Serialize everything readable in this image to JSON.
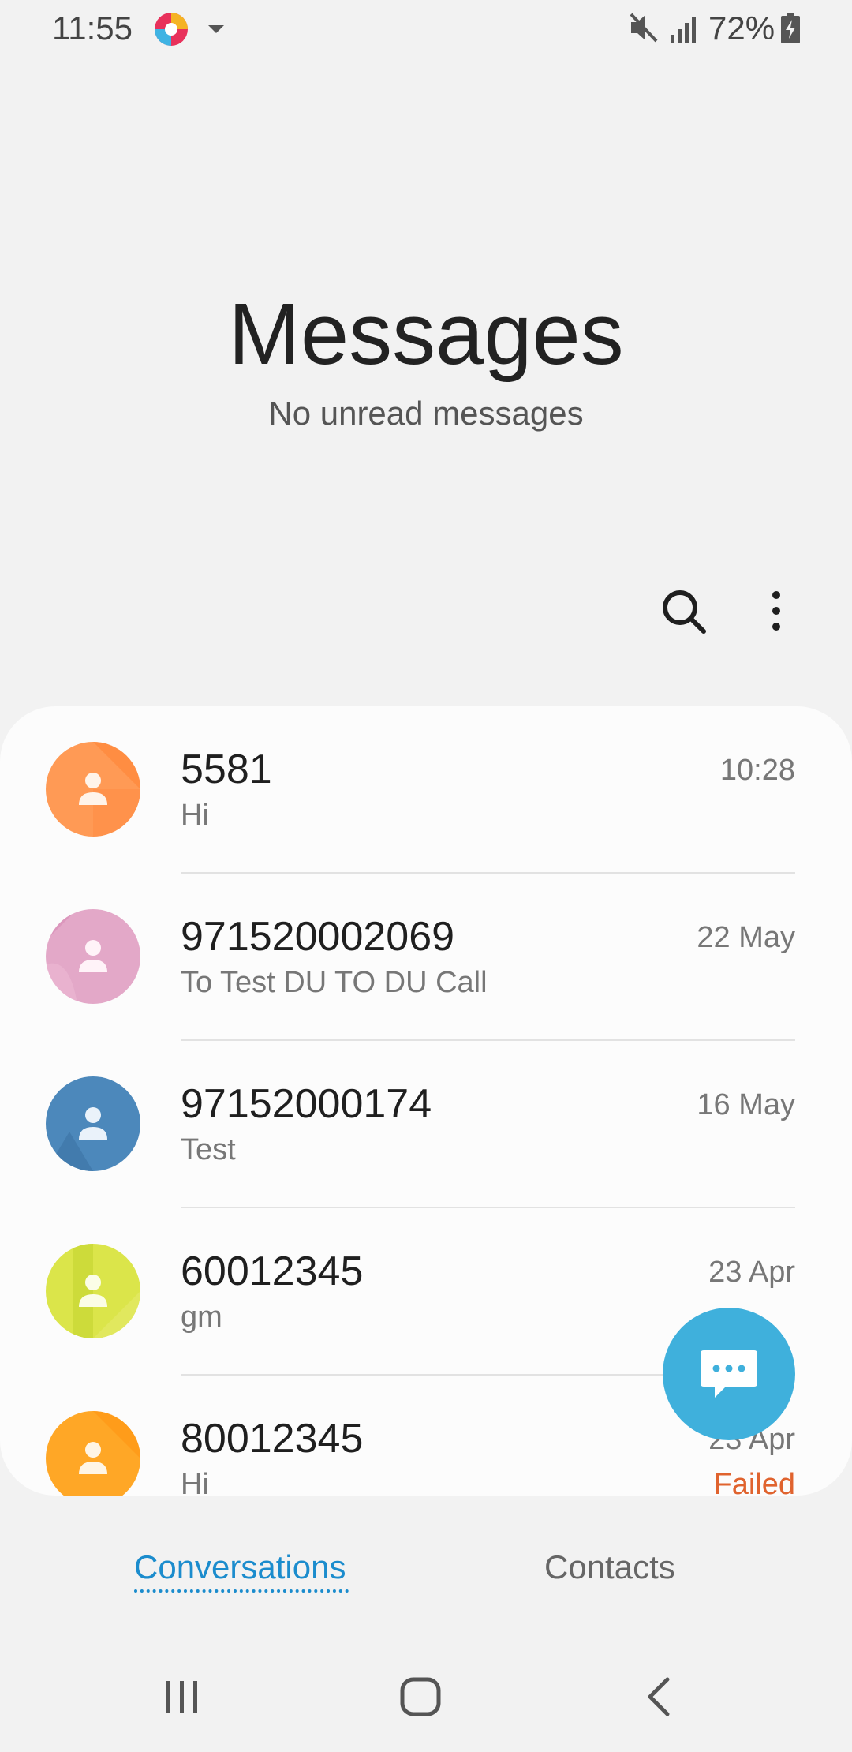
{
  "status_bar": {
    "time": "11:55",
    "battery": "72%",
    "icons": [
      "app-notification-icon",
      "dropdown-icon",
      "mute-icon",
      "signal-icon",
      "battery-charging-icon"
    ]
  },
  "header": {
    "title": "Messages",
    "subtitle": "No unread messages"
  },
  "toolbar": {
    "icons": [
      "search-icon",
      "more-options-icon"
    ]
  },
  "conversations": [
    {
      "name": "5581",
      "snippet": "Hi",
      "date": "10:28",
      "avatar_color": "#ff9a55"
    },
    {
      "name": "971520002069",
      "snippet": "To Test DU TO DU Call",
      "date": "22 May",
      "avatar_color": "#e0a1c4"
    },
    {
      "name": "97152000174",
      "snippet": "Test",
      "date": "16 May",
      "avatar_color": "#4c88bb"
    },
    {
      "name": "60012345",
      "snippet": "gm",
      "date": "23 Apr",
      "avatar_color": "#d4e23a"
    },
    {
      "name": "80012345",
      "snippet": "Hi",
      "date": "23 Apr",
      "status": "Failed",
      "avatar_color": "#ffa726"
    }
  ],
  "fab": {
    "icon": "compose-message-icon",
    "color": "#3fb0dc"
  },
  "tabs": [
    {
      "label": "Conversations",
      "active": true
    },
    {
      "label": "Contacts",
      "active": false
    }
  ],
  "nav_bar": {
    "icons": [
      "recents-icon",
      "home-icon",
      "back-icon"
    ]
  },
  "colors": {
    "accent": "#1b8ccd",
    "failed": "#e0632e"
  }
}
